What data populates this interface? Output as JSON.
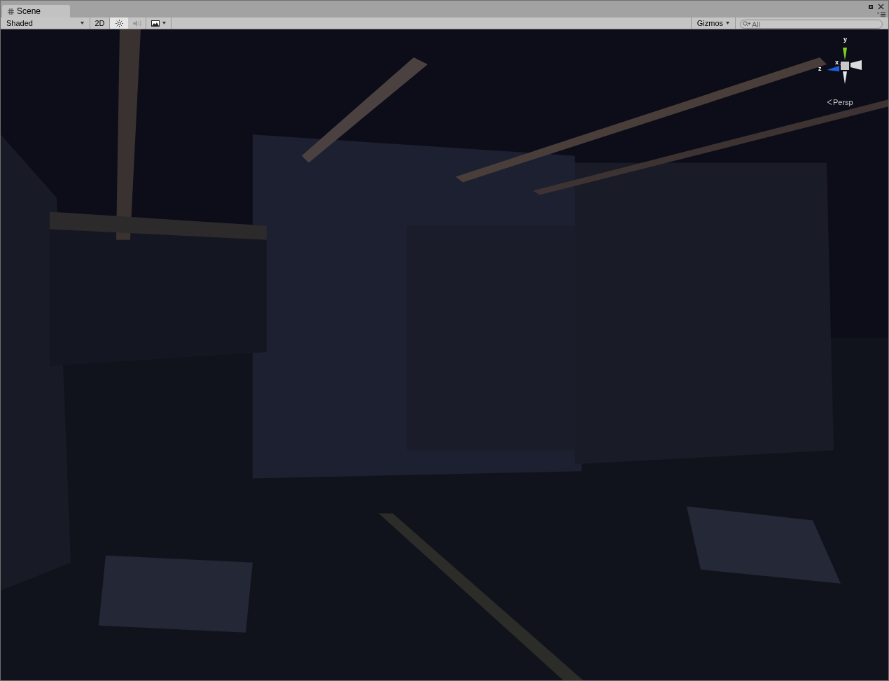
{
  "tabs": [
    {
      "label": "Scene",
      "selected": true
    }
  ],
  "toolbar": {
    "draw_mode": "Shaded",
    "mode_2d": {
      "label": "2D",
      "on": false
    },
    "lighting": {
      "on": true
    },
    "audio": {
      "on": false
    },
    "gizmos": "Gizmos",
    "search": {
      "placeholder": "All"
    }
  },
  "view": {
    "axes": {
      "y": "y",
      "x": "x",
      "z": "z"
    },
    "projection": "Persp"
  }
}
